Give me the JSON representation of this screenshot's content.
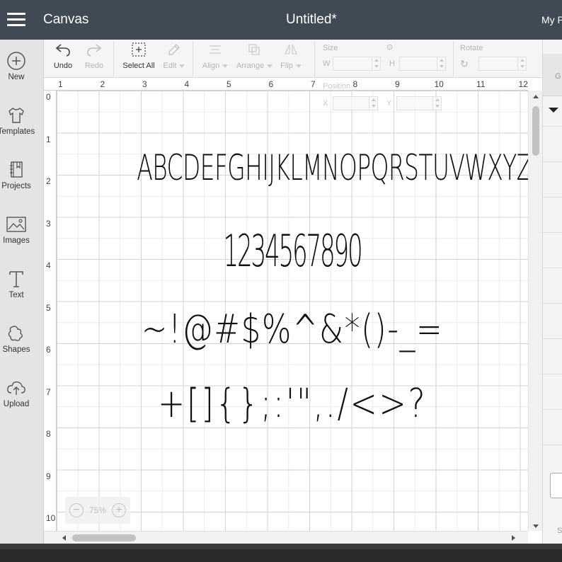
{
  "header": {
    "app_title": "Canvas",
    "document_title": "Untitled*",
    "my_projects": "My P"
  },
  "nav": [
    {
      "label": "New",
      "icon": "plus-circle-icon"
    },
    {
      "label": "Templates",
      "icon": "tshirt-icon"
    },
    {
      "label": "Projects",
      "icon": "projects-icon"
    },
    {
      "label": "Images",
      "icon": "image-icon"
    },
    {
      "label": "Text",
      "icon": "text-icon"
    },
    {
      "label": "Shapes",
      "icon": "shapes-icon"
    },
    {
      "label": "Upload",
      "icon": "upload-icon"
    }
  ],
  "toolbar": {
    "undo": "Undo",
    "redo": "Redo",
    "select_all": "Select All",
    "edit": "Edit",
    "align": "Align",
    "arrange": "Arrange",
    "flip": "Flip",
    "size": "Size",
    "w": "W",
    "h": "H",
    "rotate": "Rotate",
    "position": "Position",
    "x": "X",
    "y": "Y"
  },
  "ruler": {
    "top": [
      "1",
      "2",
      "3",
      "4",
      "5",
      "6",
      "7",
      "8",
      "9",
      "10",
      "11",
      "12"
    ],
    "left": [
      "0",
      "1",
      "2",
      "3",
      "4",
      "5",
      "6",
      "7",
      "8",
      "9",
      "10"
    ]
  },
  "canvas_text": {
    "line1": "ABCDEFGHIJKLMNOPQRSTUVWXYZ",
    "line2": "1234567890",
    "line3": "~!@#$%^&*()-_=",
    "line4": "+[]{};:'\",./<>?"
  },
  "zoom": {
    "value": "75%",
    "minus": "−",
    "plus": "+"
  },
  "right_panel": {
    "tab_label": "G",
    "bottom_label": "S"
  }
}
